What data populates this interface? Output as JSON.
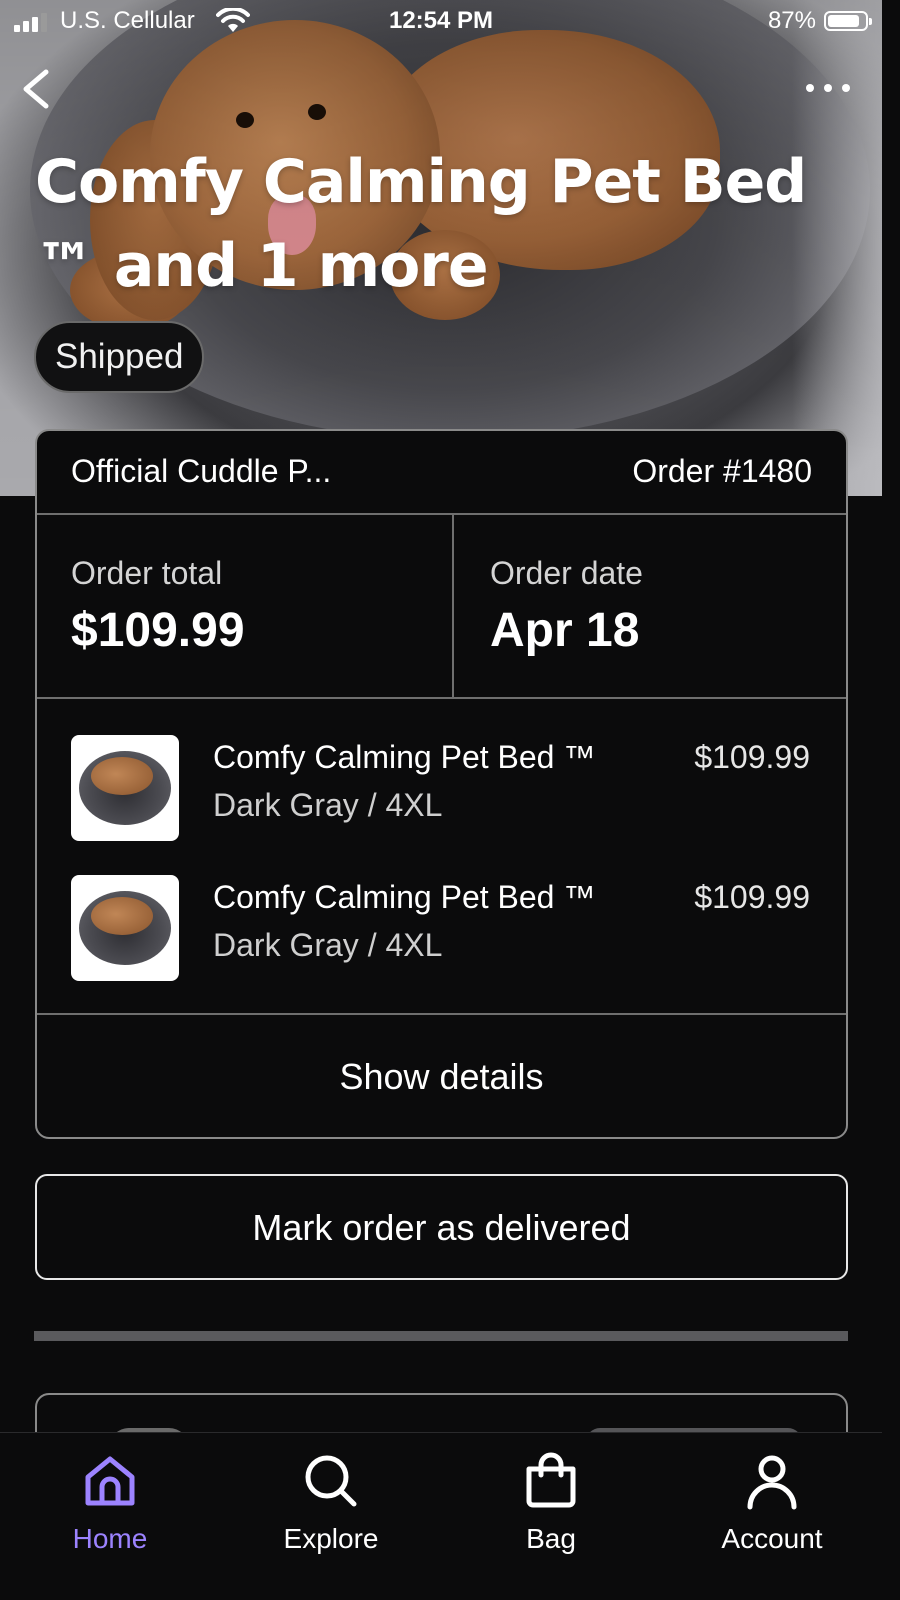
{
  "status_bar": {
    "carrier": "U.S. Cellular",
    "time": "12:54 PM",
    "battery": "87%",
    "battery_level": 0.87
  },
  "header": {
    "title": "Comfy Calming Pet Bed ™ and 1 more",
    "status_badge": "Shipped"
  },
  "order": {
    "shop_name": "Official Cuddle P...",
    "order_number": "Order #1480",
    "total_label": "Order total",
    "total_value": "$109.99",
    "date_label": "Order date",
    "date_value": "Apr 18",
    "items": [
      {
        "name": "Comfy Calming Pet Bed ™",
        "variant": "Dark Gray / 4XL",
        "price": "$109.99"
      },
      {
        "name": "Comfy Calming Pet Bed ™",
        "variant": "Dark Gray / 4XL",
        "price": "$109.99"
      }
    ],
    "show_details_label": "Show details"
  },
  "actions": {
    "mark_delivered_label": "Mark order as delivered"
  },
  "tab_bar": {
    "tabs": [
      {
        "label": "Home",
        "icon": "home-icon",
        "active": true
      },
      {
        "label": "Explore",
        "icon": "search-icon",
        "active": false
      },
      {
        "label": "Bag",
        "icon": "bag-icon",
        "active": false
      },
      {
        "label": "Account",
        "icon": "account-icon",
        "active": false
      }
    ]
  },
  "colors": {
    "background": "#0b0b0c",
    "accent": "#9c83ff",
    "border": "#8a8a8a"
  }
}
